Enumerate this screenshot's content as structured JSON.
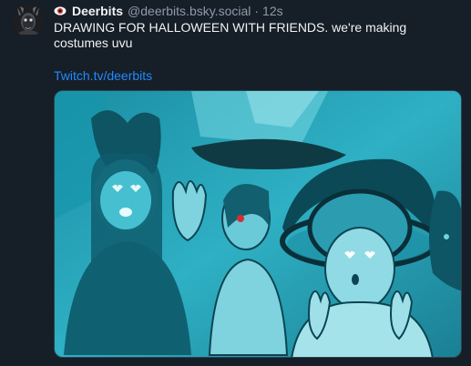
{
  "post": {
    "author": {
      "display_name": "Deerbits",
      "handle": "@deerbits.bsky.social",
      "separator": "·",
      "timestamp": "12s",
      "name_emoji": "eye-emoji-icon",
      "avatar": "deer-skull-avatar"
    },
    "text": "DRAWING FOR HALLOWEEN WITH FRIENDS. we're making costumes uvu",
    "link_text": "Twitch.tv/deerbits",
    "media": {
      "icon": "embedded-drawing-image"
    }
  },
  "colors": {
    "background": "#161e27",
    "text_primary": "#f1f3f5",
    "text_secondary": "#8d9bab",
    "link": "#208bfe",
    "media_teal": "#2aa6bb"
  }
}
